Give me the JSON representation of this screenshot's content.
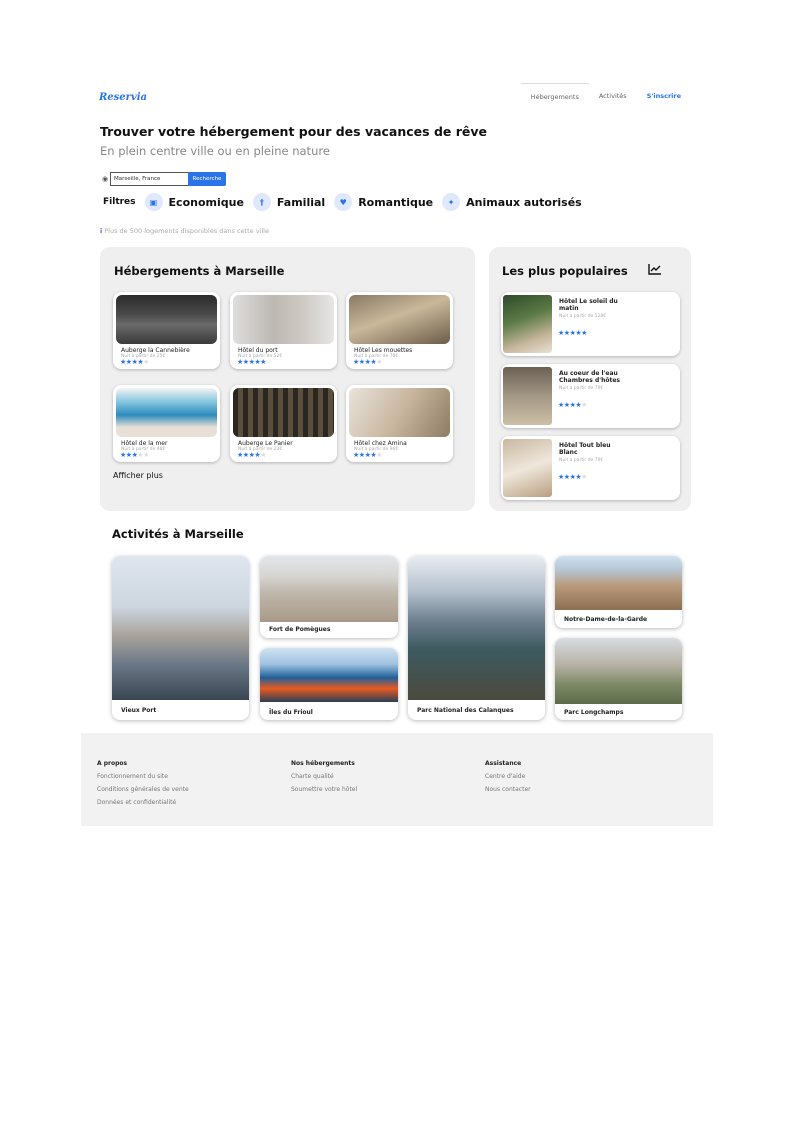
{
  "brand": {
    "name": "Reservia",
    "accent": "#2a73e8"
  },
  "nav": {
    "items": [
      "Hébergements",
      "Activités"
    ],
    "signup": "S'inscrire"
  },
  "hero": {
    "title": "Trouver votre hébergement pour des vacances de rêve",
    "subtitle": "En plein centre ville ou en pleine nature"
  },
  "search": {
    "value": "Marseille, France",
    "button": "Recherche"
  },
  "filters": {
    "label": "Filtres",
    "items": [
      {
        "label": "Economique",
        "icon": "money-icon"
      },
      {
        "label": "Familial",
        "icon": "family-icon"
      },
      {
        "label": "Romantique",
        "icon": "heart-icon"
      },
      {
        "label": "Animaux autorisés",
        "icon": "dog-icon"
      }
    ]
  },
  "info": "Plus de 500 logements disponibles dans cette ville",
  "lodgings": {
    "title": "Hébergements à Marseille",
    "more": "Afficher plus",
    "items": [
      {
        "name": "Auberge la Cannebière",
        "price": "Nuit à partir de 25€",
        "rating": 4
      },
      {
        "name": "Hôtel du port",
        "price": "Nuit à partir de 52€",
        "rating": 5
      },
      {
        "name": "Hôtel Les mouettes",
        "price": "Nuit à partir de 76€",
        "rating": 4
      },
      {
        "name": "Hôtel de la mer",
        "price": "Nuit à partir de 46€",
        "rating": 3
      },
      {
        "name": "Auberge Le Panier",
        "price": "Nuit à partir de 23€",
        "rating": 4
      },
      {
        "name": "Hôtel chez Amina",
        "price": "Nuit à partir de 96€",
        "rating": 4
      }
    ]
  },
  "popular": {
    "title": "Les plus populaires",
    "items": [
      {
        "name": "Hôtel Le soleil du matin",
        "price": "Nuit à partir de 128€",
        "rating": 5
      },
      {
        "name": "Au coeur de l'eau Chambres d'hôtes",
        "price": "Nuit à partir de 70€",
        "rating": 4
      },
      {
        "name": "Hôtel Tout bleu Blanc",
        "price": "Nuit à partir de 70€",
        "rating": 4
      }
    ]
  },
  "activities": {
    "title": "Activités à Marseille",
    "items": [
      "Vieux Port",
      "Fort de Pomègues",
      "Îles du Frioul",
      "Parc National des Calanques",
      "Notre-Dame-de-la-Garde",
      "Parc Longchamps"
    ]
  },
  "footer": {
    "columns": [
      {
        "heading": "A propos",
        "links": [
          "Fonctionnement du site",
          "Conditions générales de vente",
          "Données et confidentialité"
        ]
      },
      {
        "heading": "Nos hébergements",
        "links": [
          "Charte qualité",
          "Soumettre votre hôtel"
        ]
      },
      {
        "heading": "Assistance",
        "links": [
          "Centre d'aide",
          "Nous contacter"
        ]
      }
    ]
  }
}
